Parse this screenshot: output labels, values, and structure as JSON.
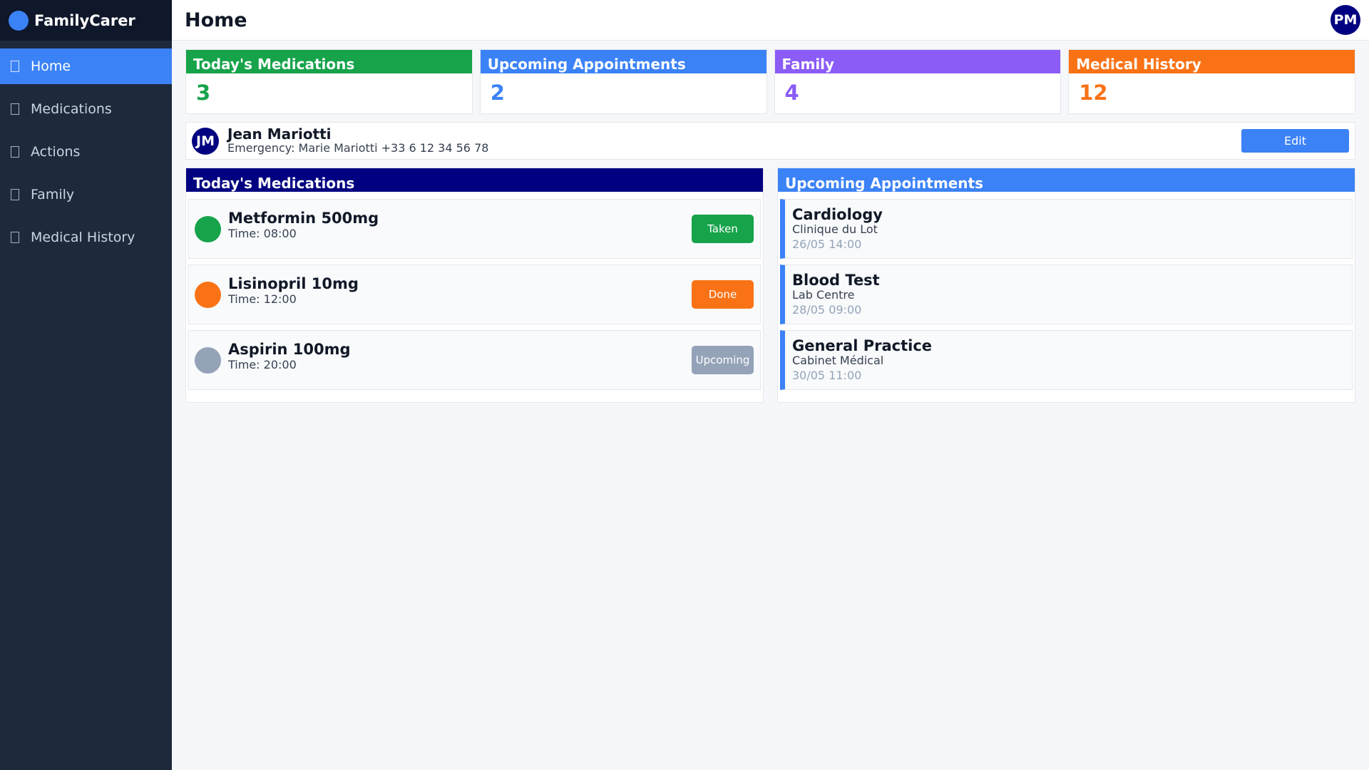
{
  "brand": {
    "name": "FamilyCarer"
  },
  "sidebar": {
    "items": [
      {
        "label": "Home",
        "active": true
      },
      {
        "label": "Medications",
        "active": false
      },
      {
        "label": "Actions",
        "active": false
      },
      {
        "label": "Family",
        "active": false
      },
      {
        "label": "Medical History",
        "active": false
      }
    ]
  },
  "header": {
    "title": "Home",
    "user_initials": "PM"
  },
  "stats": [
    {
      "label": "Today's Medications",
      "value": "3",
      "color": "#16a34a"
    },
    {
      "label": "Upcoming Appointments",
      "value": "2",
      "color": "#3b82f6"
    },
    {
      "label": "Family",
      "value": "4",
      "color": "#8b5cf6"
    },
    {
      "label": "Medical History",
      "value": "12",
      "color": "#f97316"
    }
  ],
  "patient": {
    "initials": "JM",
    "name": "Jean Mariotti",
    "emergency": "Emergency: Marie Mariotti  +33 6 12 34 56 78",
    "edit_label": "Edit"
  },
  "medications": {
    "title": "Today's Medications",
    "header_color": "#000080",
    "items": [
      {
        "name": "Metformin 500mg",
        "time": "Time: 08:00",
        "status": "Taken",
        "color": "#16a34a"
      },
      {
        "name": "Lisinopril 10mg",
        "time": "Time: 12:00",
        "status": "Done",
        "color": "#f97316"
      },
      {
        "name": "Aspirin 100mg",
        "time": "Time: 20:00",
        "status": "Upcoming",
        "color": "#94a3b8"
      }
    ]
  },
  "appointments": {
    "title": "Upcoming Appointments",
    "header_color": "#3b82f6",
    "items": [
      {
        "title": "Cardiology",
        "place": "Clinique du Lot",
        "date": "26/05 14:00"
      },
      {
        "title": "Blood Test",
        "place": "Lab Centre",
        "date": "28/05 09:00"
      },
      {
        "title": "General Practice",
        "place": "Cabinet Médical",
        "date": "30/05 11:00"
      }
    ]
  }
}
